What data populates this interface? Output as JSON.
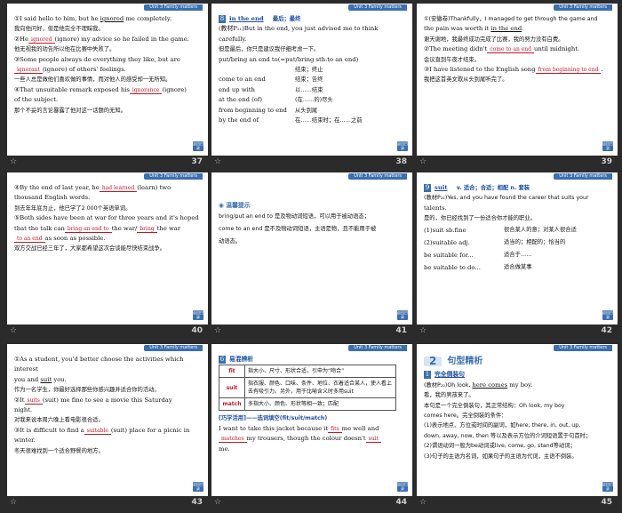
{
  "unit_tag": "Unit 3   Family matters",
  "back_label": "返回目录",
  "slides": [
    {
      "num": "37",
      "lines": [
        [
          "①I said hello to him, but he ",
          {
            "u": "ignored"
          },
          " me completely."
        ],
        [
          "我向他问好，但是他完全不理睬我。"
        ],
        [
          "②He",
          {
            "f": "ignored"
          },
          "(ignore) my advice so he failed in the game."
        ],
        [
          "他无视我的劝告所以他在比赛中失败了。"
        ],
        [
          "③Some people always do everything they like, but are"
        ],
        [
          {
            "f": "ignorant"
          },
          "(ignore) of others' feelings."
        ],
        [
          "一些人总是做他们喜欢做的事情，而对他人的感受却一无所知。"
        ],
        [
          "④That unsuitable remark exposed his",
          {
            "f": "ignorance"
          },
          "(ignore)"
        ],
        [
          "of the subject."
        ],
        [
          "那个不妥的言论暴露了他对这一话题的无知。"
        ]
      ]
    },
    {
      "num": "38",
      "heading_num": "8",
      "heading_word": "in the end",
      "heading_cn": "最后；最终",
      "example": "(教材P₂₁)But in the end, you just advised me to think carefully.",
      "example_cn": "但是最后，你只是建议我仔细考虑一下。",
      "intro": "put/bring an end to(=put/bring sth.to an end)",
      "intro_cn": "结束；终止",
      "phrases": [
        {
          "en": "come to an end",
          "cn": "结束；告终"
        },
        {
          "en": "end up with",
          "cn": "以……结束"
        },
        {
          "en": "at the end (of)",
          "cn": "(在……的)尽头"
        },
        {
          "en": "from beginning to end",
          "cn": "从头到尾"
        },
        {
          "en": "by the end of",
          "cn": "在……结束时；在……之前"
        }
      ]
    },
    {
      "num": "39",
      "lines": [
        [
          "①(安徽卷)Thankfully，I managed to get through the game and"
        ],
        [
          "the pain was worth it ",
          {
            "u": "in the end"
          },
          "."
        ],
        [
          "谢天谢地，我最终成功完成了比赛，我的努力没有白费。"
        ],
        [
          "②The meeting didn't",
          {
            "f": "come to an end"
          },
          "until midnight."
        ],
        [
          "会议直到午夜才结束。"
        ],
        [
          "③I have listened to the English song",
          {
            "f": "from beginning to end"
          },
          "."
        ],
        [
          "我把这首英文歌从头到尾听完了。"
        ]
      ]
    },
    {
      "num": "40",
      "lines": [
        [
          "④By the end of last year, he",
          {
            "f": "had learned"
          },
          "(learn) two"
        ],
        [
          "thousand English words."
        ],
        [
          "到去年年底为止，他已学了2 000个英语单词。"
        ],
        [
          "⑤Both sides have been at war for three years and it's hoped"
        ],
        [
          "that the talk can",
          {
            "f": "bring an end to"
          },
          "the war/",
          {
            "f": "bring"
          },
          "the war"
        ],
        [
          {
            "f": "to an end"
          },
          "as soon as possible."
        ],
        [
          "双方交战已经三年了，大家都希望这次会谈能尽快结束战争。"
        ]
      ]
    },
    {
      "num": "41",
      "tip_label": "温馨提示",
      "tip_lines": [
        "bring/put an end to 是及物动词短语，可以用于被动语态；",
        "come to an end 是不及物动词短语，主语是物，且不能用于被",
        "动语态。"
      ]
    },
    {
      "num": "42",
      "heading_num": "9",
      "heading_word": "suit",
      "heading_cn": "v.  适合；合适；相配   n. 套装",
      "example": "(教材P₂₁)Yes, and you have found the career that suits your",
      "example2": "talents.",
      "example_cn": "是的，你已经找到了一份适合你才能的职业。",
      "phrases": [
        {
          "en": "(1)suit sb.fine",
          "cn": "很合某人的意；对某人很合适"
        },
        {
          "en": "(2)suitable adj.",
          "cn": "适当的；相配的；恰当的"
        },
        {
          "en": "be suitable for...",
          "cn": "适合于……"
        },
        {
          "en": "be suitable to do...",
          "cn": "适合做某事"
        }
      ]
    },
    {
      "num": "43",
      "lines": [
        [
          "①As a student, you'd better choose the activities which interest"
        ],
        [
          "you and ",
          {
            "u": "suit"
          },
          " you."
        ],
        [
          "作为一名学生，你最好选择那些你感兴趣并适合你的活动。"
        ],
        [
          "②It",
          {
            "f": "suits"
          },
          "(suit) me fine to see a movie this Saturday"
        ],
        [
          "night."
        ],
        [
          "对我来说本周六晚上看电影很合适。"
        ],
        [
          "③It is difficult to find a",
          {
            "f": "suitable"
          },
          "(suit) place for a picnic in"
        ],
        [
          "winter."
        ],
        [
          "冬天很难找到一个适合野餐的地方。"
        ]
      ]
    },
    {
      "num": "44",
      "heading_num": "6",
      "heading_word": "易混辨析",
      "table": [
        {
          "k": "fit",
          "v": "指大小、尺寸、形状合适，引申为“吻合”"
        },
        {
          "k": "suit",
          "v": "指衣服、颜色、口味、条件、地位、衣着适合某人，使人看上去有吸引力。另外，用于比喻含义时多用suit"
        },
        {
          "k": "match",
          "v": "多指大小、颜色、形状等相一致；匹配"
        }
      ],
      "practice_title": "[巧学活用]——选词填空(fit/suit/match)",
      "practice": [
        [
          "I want to take this jacket because it",
          {
            "f": "fits"
          },
          "me well and"
        ],
        [
          {
            "f": "matches"
          },
          "my trousers, though the colour doesn't",
          {
            "f": "suit"
          }
        ],
        [
          "me."
        ]
      ]
    },
    {
      "num": "45",
      "section_num": "2",
      "section_title": "句型精析",
      "heading_num": "1",
      "heading_word": "完全倒装句",
      "lines": [
        [
          "(教材P₂₂)Oh look, ",
          {
            "u": "here comes"
          },
          " my boy."
        ],
        [
          "看，我的男孩来了。"
        ],
        [
          "本句是一个完全倒装句，其正常结构：Oh look, my boy"
        ],
        [
          "comes here。完全倒装的条件："
        ],
        [
          "(1)表示地点、方位或时间的副词，如here, there, in, out, up,"
        ],
        [
          "down, away, now, then 等以及表示方位的介词短语置于句首时；"
        ],
        [
          "(2)谓语动词一般为be动词或live, come, go, stand等动词；"
        ],
        [
          "(3)句子的主语为名词，如果句子的主语为代词，主语不倒装。"
        ]
      ]
    }
  ]
}
